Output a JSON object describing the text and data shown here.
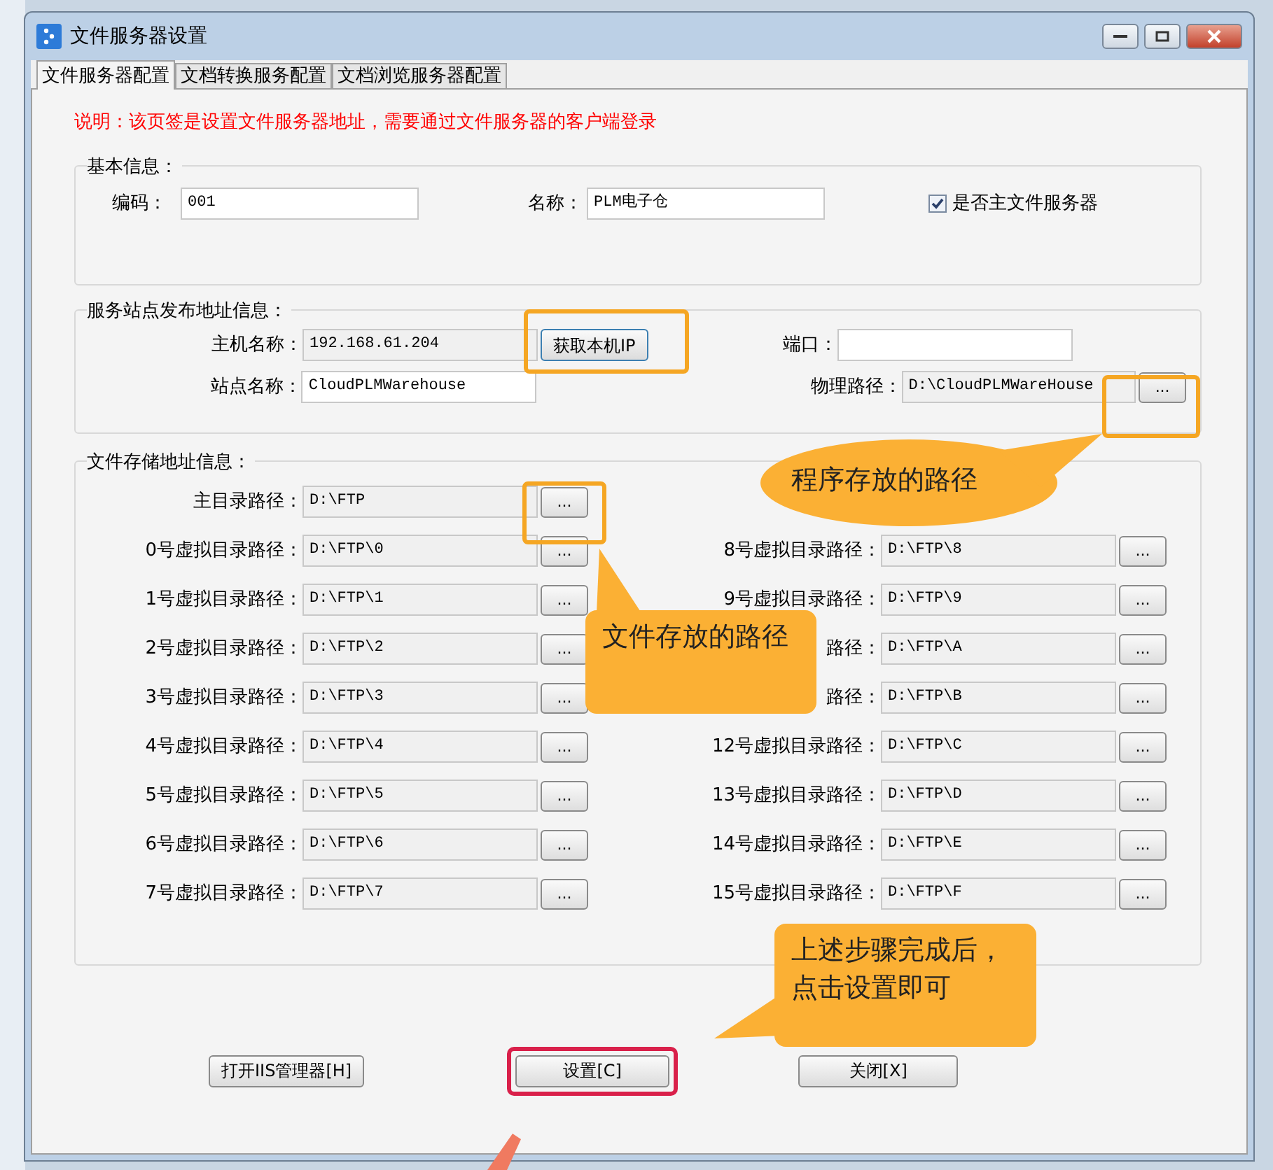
{
  "window": {
    "title": "文件服务器设置"
  },
  "tabs": [
    {
      "label": "文件服务器配置",
      "selected": true
    },
    {
      "label": "文档转换服务配置",
      "selected": false
    },
    {
      "label": "文档浏览服务器配置",
      "selected": false
    }
  ],
  "note": "说明：该页签是设置文件服务器地址，需要通过文件服务器的客户端登录",
  "basic": {
    "title": "基本信息：",
    "code_label": "编码：",
    "code_value": "001",
    "name_label": "名称：",
    "name_value": "PLM电子仓",
    "primary_label": "是否主文件服务器",
    "primary_checked": true
  },
  "service": {
    "title": "服务站点发布地址信息：",
    "host_label": "主机名称：",
    "host_value": "192.168.61.204",
    "get_ip_button": "获取本机IP",
    "port_label": "端口：",
    "site_label": "站点名称：",
    "site_value": "CloudPLMWarehouse",
    "path_label": "物理路径：",
    "path_value": "D:\\CloudPLMWareHouse",
    "browse": "..."
  },
  "storage": {
    "title": "文件存储地址信息：",
    "main_label": "主目录路径：",
    "main_value": "D:\\FTP",
    "browse": "...",
    "left": [
      {
        "label": "0号虚拟目录路径：",
        "value": "D:\\FTP\\0"
      },
      {
        "label": "1号虚拟目录路径：",
        "value": "D:\\FTP\\1"
      },
      {
        "label": "2号虚拟目录路径：",
        "value": "D:\\FTP\\2"
      },
      {
        "label": "3号虚拟目录路径：",
        "value": "D:\\FTP\\3"
      },
      {
        "label": "4号虚拟目录路径：",
        "value": "D:\\FTP\\4"
      },
      {
        "label": "5号虚拟目录路径：",
        "value": "D:\\FTP\\5"
      },
      {
        "label": "6号虚拟目录路径：",
        "value": "D:\\FTP\\6"
      },
      {
        "label": "7号虚拟目录路径：",
        "value": "D:\\FTP\\7"
      }
    ],
    "right": [
      {
        "label": "8号虚拟目录路径：",
        "value": "D:\\FTP\\8"
      },
      {
        "label": "9号虚拟目录路径：",
        "value": "D:\\FTP\\9"
      },
      {
        "label": "路径：",
        "value": "D:\\FTP\\A"
      },
      {
        "label": "路径：",
        "value": "D:\\FTP\\B"
      },
      {
        "label": "12号虚拟目录路径：",
        "value": "D:\\FTP\\C"
      },
      {
        "label": "13号虚拟目录路径：",
        "value": "D:\\FTP\\D"
      },
      {
        "label": "14号虚拟目录路径：",
        "value": "D:\\FTP\\E"
      },
      {
        "label": "15号虚拟目录路径：",
        "value": "D:\\FTP\\F"
      }
    ]
  },
  "buttons": [
    {
      "label": "打开IIS管理器[H]",
      "highlighted": false
    },
    {
      "label": "设置[C]",
      "highlighted": true
    },
    {
      "label": "关闭[X]",
      "highlighted": false
    }
  ],
  "callouts": [
    {
      "kind": "ellipse",
      "text": "程序存放的路径"
    },
    {
      "kind": "box",
      "text": "文件存放的路径"
    },
    {
      "kind": "box",
      "text": "上述步骤完成后，点击设置即可"
    }
  ]
}
